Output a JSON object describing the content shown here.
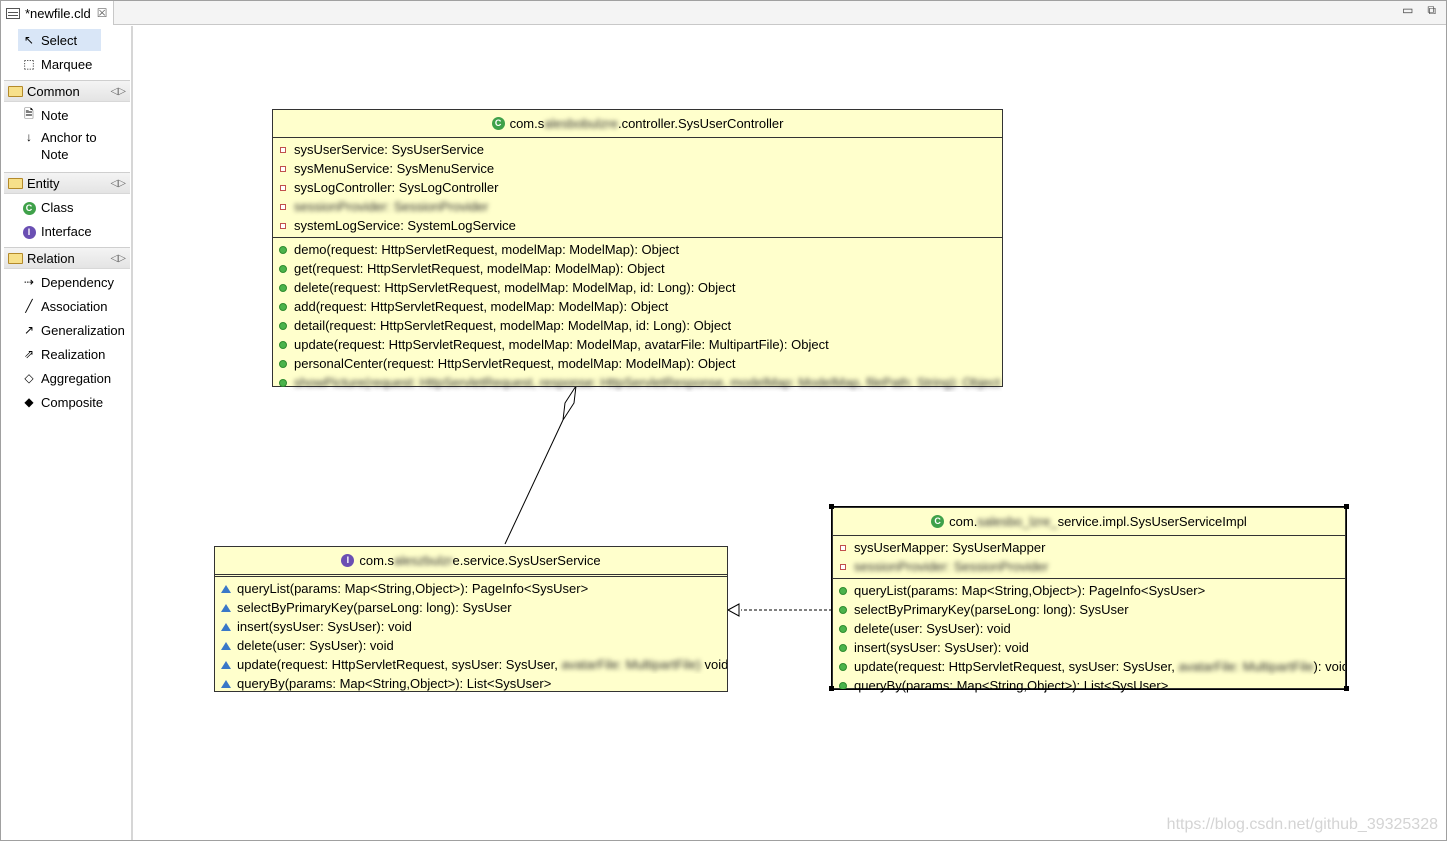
{
  "editor": {
    "tab_title": "*newfile.cld",
    "tab_close": "☒",
    "minimize_glyph": "▭",
    "maximize_glyph": "⧉"
  },
  "palette": {
    "tools": [
      {
        "label": "Select",
        "icon": "pointer-icon"
      },
      {
        "label": "Marquee",
        "icon": "marquee-icon"
      }
    ],
    "drawers": [
      {
        "label": "Common",
        "items": [
          {
            "label": "Note",
            "icon": "note-icon"
          },
          {
            "label": "Anchor to\nNote",
            "icon": "anchor-icon"
          }
        ]
      },
      {
        "label": "Entity",
        "items": [
          {
            "label": "Class",
            "icon": "class-icon"
          },
          {
            "label": "Interface",
            "icon": "interface-icon"
          }
        ]
      },
      {
        "label": "Relation",
        "items": [
          {
            "label": "Dependency",
            "icon": "dependency-icon"
          },
          {
            "label": "Association",
            "icon": "association-icon"
          },
          {
            "label": "Generalization",
            "icon": "generalization-icon"
          },
          {
            "label": "Realization",
            "icon": "realization-icon"
          },
          {
            "label": "Aggregation",
            "icon": "aggregation-icon"
          },
          {
            "label": "Composite",
            "icon": "composite-icon"
          }
        ]
      }
    ]
  },
  "diagram": {
    "controller": {
      "title": "com.s                              .controller.SysUserController",
      "title_visible_prefix": "com.s",
      "title_suffix": ".controller.SysUserController",
      "fields": [
        "sysUserService: SysUserService",
        "sysMenuService: SysMenuService",
        "sysLogController: SysLogController",
        "sessionProvider: SessionProvider",
        "systemLogService: SystemLogService"
      ],
      "methods": [
        "demo(request: HttpServletRequest, modelMap: ModelMap): Object",
        "get(request: HttpServletRequest, modelMap: ModelMap): Object",
        "delete(request: HttpServletRequest, modelMap: ModelMap, id: Long): Object",
        "add(request: HttpServletRequest, modelMap: ModelMap): Object",
        "detail(request: HttpServletRequest, modelMap: ModelMap, id: Long): Object",
        "update(request: HttpServletRequest, modelMap: ModelMap, avatarFile: MultipartFile): Object",
        "personalCenter(request: HttpServletRequest, modelMap: ModelMap): Object",
        "showPicture(request: HttpServletRequest, response: HttpServletResponse, modelMap: ModelMap, filePath: String): Object"
      ]
    },
    "service": {
      "title_prefix": "com.s",
      "title_suffix": "e.service.SysUserService",
      "methods": [
        "queryList(params: Map<String,Object>): PageInfo<SysUser>",
        "selectByPrimaryKey(parseLong: long): SysUser",
        "insert(sysUser: SysUser): void",
        "delete(user: SysUser): void",
        "update(request: HttpServletRequest, sysUser: SysUser,",
        "queryBy(params: Map<String,Object>): List<SysUser>"
      ],
      "update_tail": "void"
    },
    "impl": {
      "title_prefix": "com.",
      "title_suffix": "service.impl.SysUserServiceImpl",
      "fields": [
        "sysUserMapper: SysUserMapper"
      ],
      "methods": [
        "queryList(params: Map<String,Object>): PageInfo<SysUser>",
        "selectByPrimaryKey(parseLong: long): SysUser",
        "delete(user: SysUser): void",
        "insert(sysUser: SysUser): void",
        "update(request: HttpServletRequest, sysUser: SysUser,",
        "queryBy(params: Map<String,Object>): List<SysUser>"
      ],
      "update_tail": "): void"
    }
  },
  "watermark": "https://blog.csdn.net/github_39325328",
  "colors": {
    "class_fill": "#ffffcc",
    "selection": "#d9e6f7"
  }
}
